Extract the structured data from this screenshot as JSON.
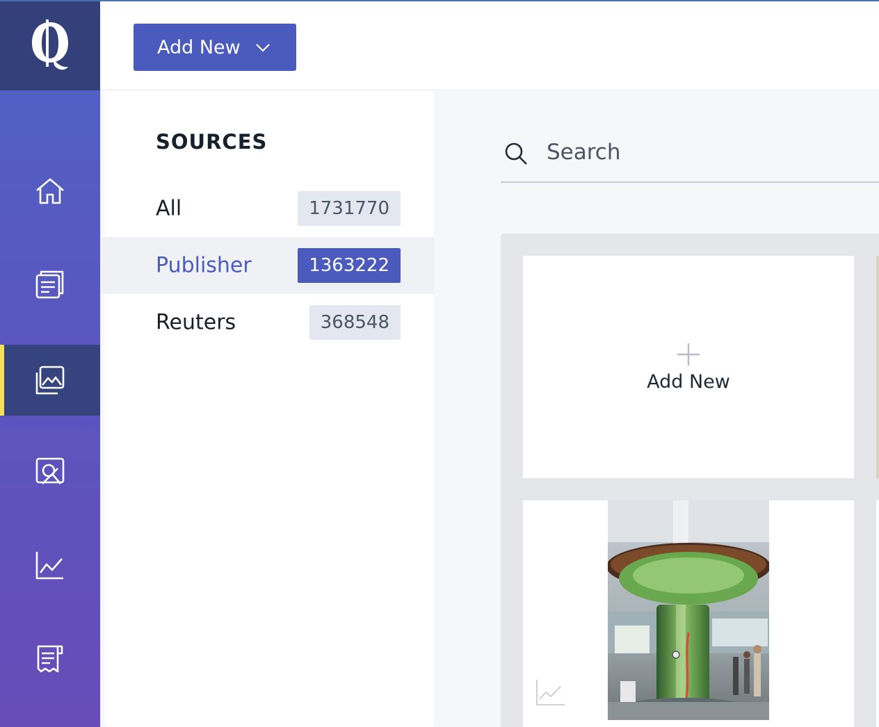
{
  "toolbar": {
    "add_new_label": "Add New"
  },
  "sources": {
    "title": "SOURCES",
    "items": [
      {
        "label": "All",
        "count": "1731770"
      },
      {
        "label": "Publisher",
        "count": "1363222",
        "selected": true
      },
      {
        "label": "Reuters",
        "count": "368548"
      }
    ]
  },
  "search": {
    "placeholder": "Search",
    "value": ""
  },
  "gallery": {
    "add_new_label": "Add New"
  },
  "sidebar": {
    "items": [
      {
        "icon": "home-icon"
      },
      {
        "icon": "stories-icon"
      },
      {
        "icon": "media-gallery-icon",
        "active": true
      },
      {
        "icon": "review-icon"
      },
      {
        "icon": "analytics-icon"
      },
      {
        "icon": "forms-icon"
      }
    ]
  },
  "colors": {
    "accent": "#4a5bbd",
    "rail_active": "#35437f",
    "active_marker": "#f6e05e"
  }
}
